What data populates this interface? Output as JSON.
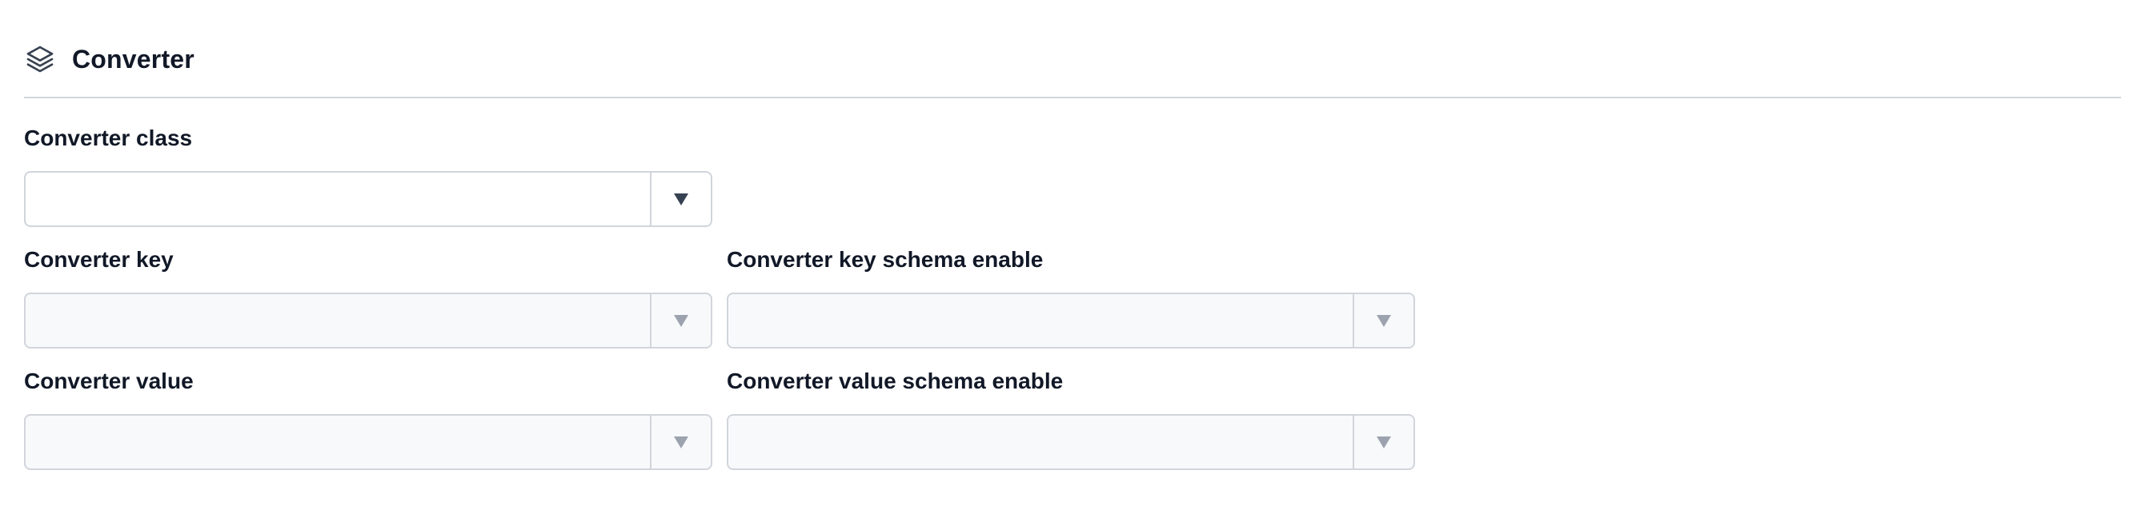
{
  "section": {
    "title": "Converter",
    "icon": "layers-icon"
  },
  "fields": {
    "converter_class": {
      "label": "Converter class",
      "value": "",
      "enabled": true
    },
    "converter_key": {
      "label": "Converter key",
      "value": "",
      "enabled": false
    },
    "converter_key_schema_enable": {
      "label": "Converter key schema enable",
      "value": "",
      "enabled": false
    },
    "converter_value": {
      "label": "Converter value",
      "value": "",
      "enabled": false
    },
    "converter_value_schema_enable": {
      "label": "Converter value schema enable",
      "value": "",
      "enabled": false
    }
  },
  "colors": {
    "text": "#111827",
    "border": "#d1d5db",
    "disabled_bg": "#f8f9fb",
    "caret_enabled": "#374151",
    "caret_disabled": "#9ca3af"
  }
}
